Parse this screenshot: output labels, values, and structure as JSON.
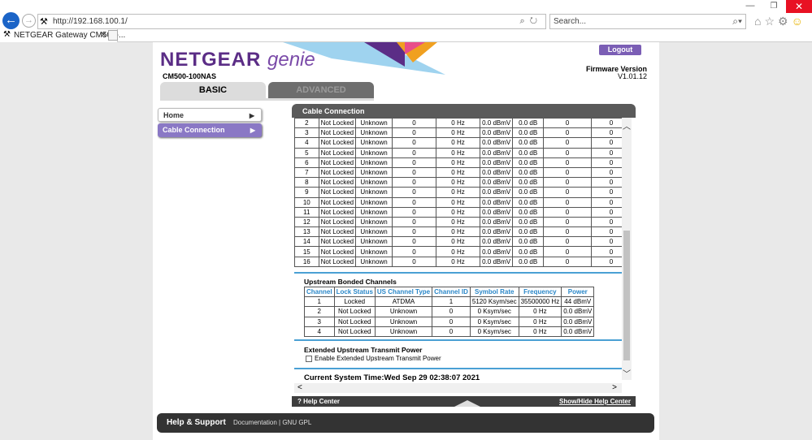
{
  "browser": {
    "url": "http://192.168.100.1/",
    "search_placeholder": "Search...",
    "tab_title": "NETGEAR Gateway CM500-..."
  },
  "header": {
    "logo_main": "NETGEAR",
    "logo_sub": "genie",
    "model": "CM500-100NAS",
    "logout": "Logout",
    "firmware_label": "Firmware Version",
    "firmware_value": "V1.01.12",
    "tab_basic": "BASIC",
    "tab_advanced": "ADVANCED"
  },
  "menu": {
    "home": "Home",
    "cable": "Cable Connection"
  },
  "panel": {
    "title": "Cable Connection",
    "help_center": "Help Center",
    "show_hide": "Show/Hide Help Center"
  },
  "downstream_rows": [
    [
      "2",
      "Not Locked",
      "Unknown",
      "0",
      "0 Hz",
      "0.0 dBmV",
      "0.0 dB",
      "0",
      "0"
    ],
    [
      "3",
      "Not Locked",
      "Unknown",
      "0",
      "0 Hz",
      "0.0 dBmV",
      "0.0 dB",
      "0",
      "0"
    ],
    [
      "4",
      "Not Locked",
      "Unknown",
      "0",
      "0 Hz",
      "0.0 dBmV",
      "0.0 dB",
      "0",
      "0"
    ],
    [
      "5",
      "Not Locked",
      "Unknown",
      "0",
      "0 Hz",
      "0.0 dBmV",
      "0.0 dB",
      "0",
      "0"
    ],
    [
      "6",
      "Not Locked",
      "Unknown",
      "0",
      "0 Hz",
      "0.0 dBmV",
      "0.0 dB",
      "0",
      "0"
    ],
    [
      "7",
      "Not Locked",
      "Unknown",
      "0",
      "0 Hz",
      "0.0 dBmV",
      "0.0 dB",
      "0",
      "0"
    ],
    [
      "8",
      "Not Locked",
      "Unknown",
      "0",
      "0 Hz",
      "0.0 dBmV",
      "0.0 dB",
      "0",
      "0"
    ],
    [
      "9",
      "Not Locked",
      "Unknown",
      "0",
      "0 Hz",
      "0.0 dBmV",
      "0.0 dB",
      "0",
      "0"
    ],
    [
      "10",
      "Not Locked",
      "Unknown",
      "0",
      "0 Hz",
      "0.0 dBmV",
      "0.0 dB",
      "0",
      "0"
    ],
    [
      "11",
      "Not Locked",
      "Unknown",
      "0",
      "0 Hz",
      "0.0 dBmV",
      "0.0 dB",
      "0",
      "0"
    ],
    [
      "12",
      "Not Locked",
      "Unknown",
      "0",
      "0 Hz",
      "0.0 dBmV",
      "0.0 dB",
      "0",
      "0"
    ],
    [
      "13",
      "Not Locked",
      "Unknown",
      "0",
      "0 Hz",
      "0.0 dBmV",
      "0.0 dB",
      "0",
      "0"
    ],
    [
      "14",
      "Not Locked",
      "Unknown",
      "0",
      "0 Hz",
      "0.0 dBmV",
      "0.0 dB",
      "0",
      "0"
    ],
    [
      "15",
      "Not Locked",
      "Unknown",
      "0",
      "0 Hz",
      "0.0 dBmV",
      "0.0 dB",
      "0",
      "0"
    ],
    [
      "16",
      "Not Locked",
      "Unknown",
      "0",
      "0 Hz",
      "0.0 dBmV",
      "0.0 dB",
      "0",
      "0"
    ]
  ],
  "upstream": {
    "title": "Upstream Bonded Channels",
    "headers": [
      "Channel",
      "Lock Status",
      "US Channel Type",
      "Channel ID",
      "Symbol Rate",
      "Frequency",
      "Power"
    ],
    "rows": [
      [
        "1",
        "Locked",
        "ATDMA",
        "1",
        "5120 Ksym/sec",
        "35500000 Hz",
        "44 dBmV"
      ],
      [
        "2",
        "Not Locked",
        "Unknown",
        "0",
        "0 Ksym/sec",
        "0 Hz",
        "0.0 dBmV"
      ],
      [
        "3",
        "Not Locked",
        "Unknown",
        "0",
        "0 Ksym/sec",
        "0 Hz",
        "0.0 dBmV"
      ],
      [
        "4",
        "Not Locked",
        "Unknown",
        "0",
        "0 Ksym/sec",
        "0 Hz",
        "0.0 dBmV"
      ]
    ]
  },
  "extended": {
    "title": "Extended Upstream Transmit Power",
    "checkbox_label": "Enable Extended Upstream Transmit Power"
  },
  "system_time": "Current System Time:Wed Sep 29 02:38:07 2021",
  "footer": {
    "title": "Help & Support",
    "links": "Documentation  | GNU GPL"
  }
}
